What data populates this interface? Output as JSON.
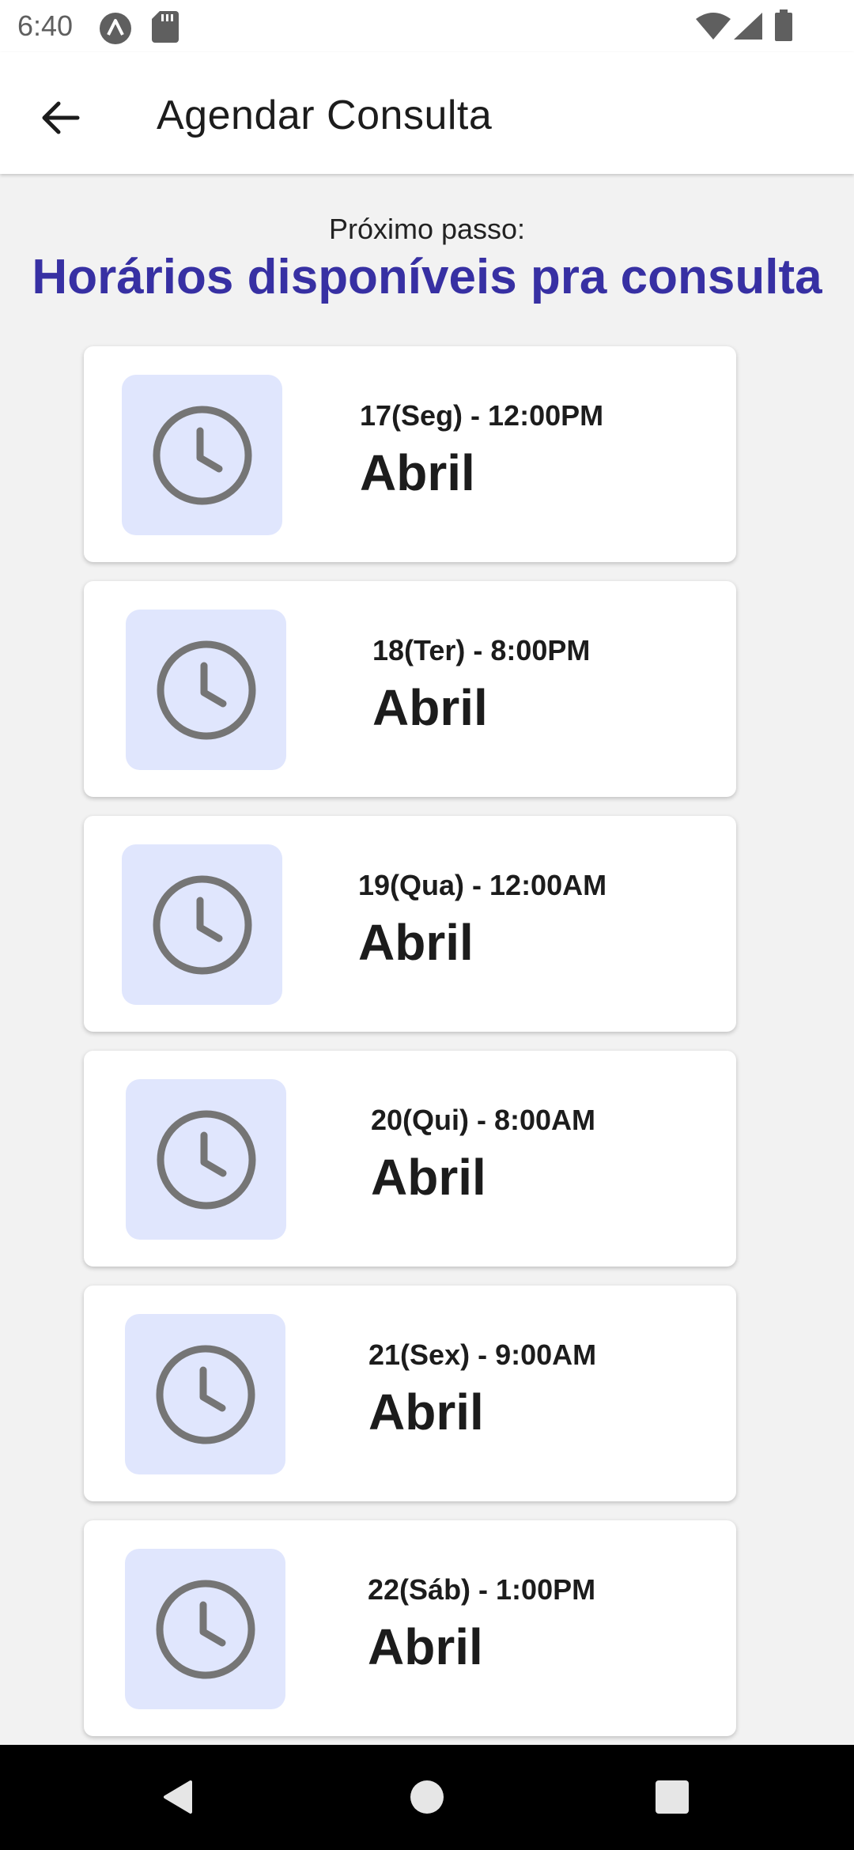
{
  "status_bar": {
    "time": "6:40",
    "left_icons": [
      "notification-a-icon",
      "sd-card-icon"
    ],
    "right_icons": [
      "wifi-icon",
      "cell-signal-icon",
      "battery-icon"
    ]
  },
  "app_bar": {
    "title": "Agendar Consulta",
    "back_icon": "arrow-back-icon"
  },
  "step": {
    "label": "Próximo passo:",
    "title": "Horários disponíveis pra consulta"
  },
  "slots": [
    {
      "date": "17(Seg) - 12:00PM",
      "month": "Abril"
    },
    {
      "date": "18(Ter) - 8:00PM",
      "month": "Abril"
    },
    {
      "date": "19(Qua) - 12:00AM",
      "month": "Abril"
    },
    {
      "date": "20(Qui) - 8:00AM",
      "month": "Abril"
    },
    {
      "date": "21(Sex) - 9:00AM",
      "month": "Abril"
    },
    {
      "date": "22(Sáb) - 1:00PM",
      "month": "Abril"
    }
  ],
  "nav_bar": {
    "buttons": [
      "back-triangle-icon",
      "home-circle-icon",
      "recents-square-icon"
    ]
  },
  "colors": {
    "accent": "#3730a3",
    "icon_box": "#e0e6fd",
    "clock_gray": "#757575",
    "background": "#f2f2f2"
  }
}
